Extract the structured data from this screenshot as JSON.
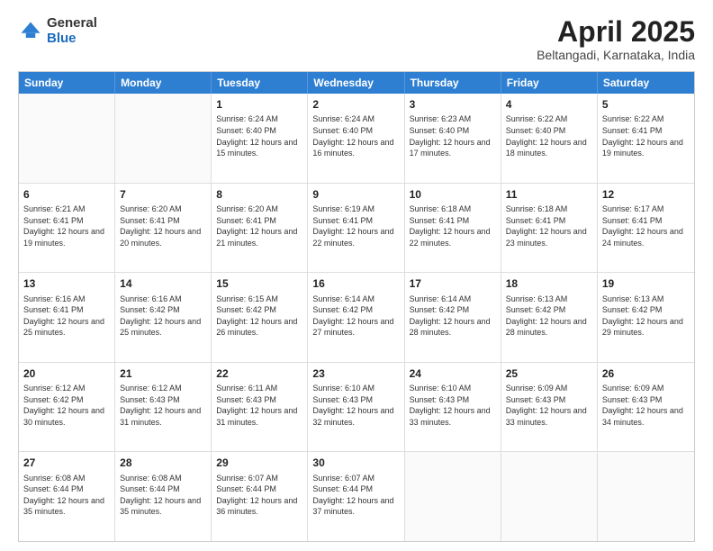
{
  "header": {
    "logo_general": "General",
    "logo_blue": "Blue",
    "month_title": "April 2025",
    "location": "Beltangadi, Karnataka, India"
  },
  "days": [
    "Sunday",
    "Monday",
    "Tuesday",
    "Wednesday",
    "Thursday",
    "Friday",
    "Saturday"
  ],
  "rows": [
    [
      {
        "day": "",
        "info": ""
      },
      {
        "day": "",
        "info": ""
      },
      {
        "day": "1",
        "info": "Sunrise: 6:24 AM\nSunset: 6:40 PM\nDaylight: 12 hours and 15 minutes."
      },
      {
        "day": "2",
        "info": "Sunrise: 6:24 AM\nSunset: 6:40 PM\nDaylight: 12 hours and 16 minutes."
      },
      {
        "day": "3",
        "info": "Sunrise: 6:23 AM\nSunset: 6:40 PM\nDaylight: 12 hours and 17 minutes."
      },
      {
        "day": "4",
        "info": "Sunrise: 6:22 AM\nSunset: 6:40 PM\nDaylight: 12 hours and 18 minutes."
      },
      {
        "day": "5",
        "info": "Sunrise: 6:22 AM\nSunset: 6:41 PM\nDaylight: 12 hours and 19 minutes."
      }
    ],
    [
      {
        "day": "6",
        "info": "Sunrise: 6:21 AM\nSunset: 6:41 PM\nDaylight: 12 hours and 19 minutes."
      },
      {
        "day": "7",
        "info": "Sunrise: 6:20 AM\nSunset: 6:41 PM\nDaylight: 12 hours and 20 minutes."
      },
      {
        "day": "8",
        "info": "Sunrise: 6:20 AM\nSunset: 6:41 PM\nDaylight: 12 hours and 21 minutes."
      },
      {
        "day": "9",
        "info": "Sunrise: 6:19 AM\nSunset: 6:41 PM\nDaylight: 12 hours and 22 minutes."
      },
      {
        "day": "10",
        "info": "Sunrise: 6:18 AM\nSunset: 6:41 PM\nDaylight: 12 hours and 22 minutes."
      },
      {
        "day": "11",
        "info": "Sunrise: 6:18 AM\nSunset: 6:41 PM\nDaylight: 12 hours and 23 minutes."
      },
      {
        "day": "12",
        "info": "Sunrise: 6:17 AM\nSunset: 6:41 PM\nDaylight: 12 hours and 24 minutes."
      }
    ],
    [
      {
        "day": "13",
        "info": "Sunrise: 6:16 AM\nSunset: 6:41 PM\nDaylight: 12 hours and 25 minutes."
      },
      {
        "day": "14",
        "info": "Sunrise: 6:16 AM\nSunset: 6:42 PM\nDaylight: 12 hours and 25 minutes."
      },
      {
        "day": "15",
        "info": "Sunrise: 6:15 AM\nSunset: 6:42 PM\nDaylight: 12 hours and 26 minutes."
      },
      {
        "day": "16",
        "info": "Sunrise: 6:14 AM\nSunset: 6:42 PM\nDaylight: 12 hours and 27 minutes."
      },
      {
        "day": "17",
        "info": "Sunrise: 6:14 AM\nSunset: 6:42 PM\nDaylight: 12 hours and 28 minutes."
      },
      {
        "day": "18",
        "info": "Sunrise: 6:13 AM\nSunset: 6:42 PM\nDaylight: 12 hours and 28 minutes."
      },
      {
        "day": "19",
        "info": "Sunrise: 6:13 AM\nSunset: 6:42 PM\nDaylight: 12 hours and 29 minutes."
      }
    ],
    [
      {
        "day": "20",
        "info": "Sunrise: 6:12 AM\nSunset: 6:42 PM\nDaylight: 12 hours and 30 minutes."
      },
      {
        "day": "21",
        "info": "Sunrise: 6:12 AM\nSunset: 6:43 PM\nDaylight: 12 hours and 31 minutes."
      },
      {
        "day": "22",
        "info": "Sunrise: 6:11 AM\nSunset: 6:43 PM\nDaylight: 12 hours and 31 minutes."
      },
      {
        "day": "23",
        "info": "Sunrise: 6:10 AM\nSunset: 6:43 PM\nDaylight: 12 hours and 32 minutes."
      },
      {
        "day": "24",
        "info": "Sunrise: 6:10 AM\nSunset: 6:43 PM\nDaylight: 12 hours and 33 minutes."
      },
      {
        "day": "25",
        "info": "Sunrise: 6:09 AM\nSunset: 6:43 PM\nDaylight: 12 hours and 33 minutes."
      },
      {
        "day": "26",
        "info": "Sunrise: 6:09 AM\nSunset: 6:43 PM\nDaylight: 12 hours and 34 minutes."
      }
    ],
    [
      {
        "day": "27",
        "info": "Sunrise: 6:08 AM\nSunset: 6:44 PM\nDaylight: 12 hours and 35 minutes."
      },
      {
        "day": "28",
        "info": "Sunrise: 6:08 AM\nSunset: 6:44 PM\nDaylight: 12 hours and 35 minutes."
      },
      {
        "day": "29",
        "info": "Sunrise: 6:07 AM\nSunset: 6:44 PM\nDaylight: 12 hours and 36 minutes."
      },
      {
        "day": "30",
        "info": "Sunrise: 6:07 AM\nSunset: 6:44 PM\nDaylight: 12 hours and 37 minutes."
      },
      {
        "day": "",
        "info": ""
      },
      {
        "day": "",
        "info": ""
      },
      {
        "day": "",
        "info": ""
      }
    ]
  ]
}
